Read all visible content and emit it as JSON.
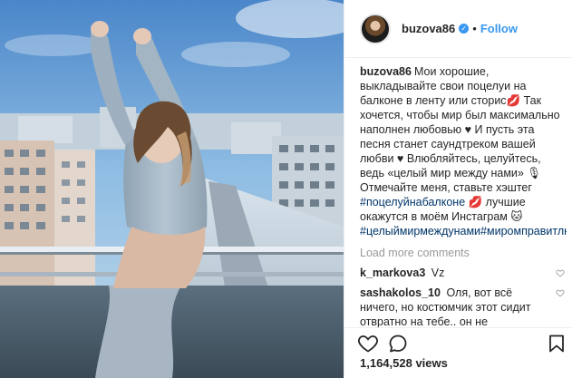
{
  "header": {
    "username": "buzova86",
    "verified_mark": "✓",
    "separator": "•",
    "follow_label": "Follow"
  },
  "caption": {
    "username": "buzova86",
    "text": "Мои хорошие, выкладывайте свои поцелуи на балконе в ленту или сторис💋 Так хочется, чтобы мир был максимально наполнен любовью ♥ И пусть эта песня станет саундтреком вашей любви ♥ Влюбляйтесь, целуйтесь, ведь «целый мир между нами» 🎙 Отмечайте меня, ставьте хэштег ",
    "tag1": "#поцелуйнабалконе",
    "text2": " 💋 лучшие окажутся в моём Инстаграм 🐱 ",
    "tag2": "#целыймирмеждунами",
    "tag3": "#миромправитлюбовь"
  },
  "load_more": "Load more comments",
  "comments": [
    {
      "username": "k_markova3",
      "text": "Vz"
    },
    {
      "username": "sashakolos_10",
      "text": "Оля, вот всё ничего, но костюмчик этот сидит отвратно на тебе.. он не подчеркивает фигуру, а далеко наоборот- присмотрись сама... у тебя ж хороший вкус в"
    }
  ],
  "actions": {
    "like_icon": "heart-outline-icon",
    "comment_icon": "speech-bubble-icon",
    "bookmark_icon": "bookmark-icon"
  },
  "likes_count": "1,164,528 views",
  "colors": {
    "accent": "#3897f0",
    "hashtag": "#003569",
    "muted": "#999999",
    "text": "#262626"
  }
}
